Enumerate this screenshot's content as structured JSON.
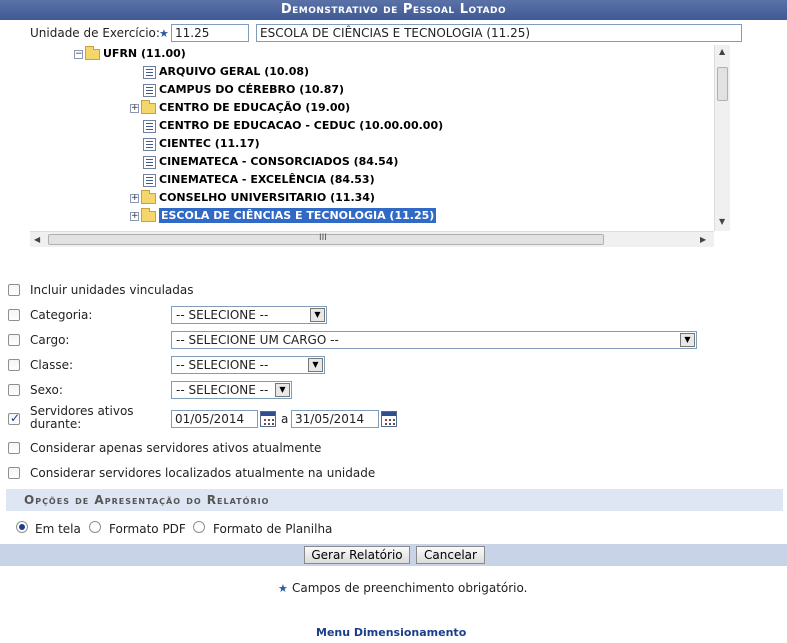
{
  "page": {
    "title": "Demonstrativo de Pessoal Lotado"
  },
  "unidade": {
    "label": "Unidade de Exercício:",
    "required_star": "★",
    "code": "11.25",
    "name": "ESCOLA DE CIÊNCIAS E TECNOLOGIA (11.25)"
  },
  "tree": {
    "root": "UFRN (11.00)",
    "items": [
      {
        "label": "ARQUIVO GERAL (10.08)",
        "icon": "document-icon",
        "expandable": false
      },
      {
        "label": "CAMPUS DO CÉREBRO (10.87)",
        "icon": "document-icon",
        "expandable": false
      },
      {
        "label": "CENTRO DE EDUCAÇÃO (19.00)",
        "icon": "folder-icon",
        "expandable": true
      },
      {
        "label": "CENTRO DE EDUCACAO - CEDUC (10.00.00.00)",
        "icon": "document-icon",
        "expandable": false
      },
      {
        "label": "CIENTEC (11.17)",
        "icon": "document-icon",
        "expandable": false
      },
      {
        "label": "CINEMATECA - CONSORCIADOS (84.54)",
        "icon": "document-icon",
        "expandable": false
      },
      {
        "label": "CINEMATECA - EXCELÊNCIA (84.53)",
        "icon": "document-icon",
        "expandable": false
      },
      {
        "label": "CONSELHO UNIVERSITARIO (11.34)",
        "icon": "folder-icon",
        "expandable": true
      },
      {
        "label": "ESCOLA DE CIÊNCIAS E TECNOLOGIA (11.25)",
        "icon": "folder-icon",
        "expandable": true,
        "selected": true
      }
    ],
    "hscroll_grip": "III"
  },
  "filters": {
    "incluir_unidades": {
      "label": "Incluir unidades vinculadas",
      "checked": false
    },
    "categoria": {
      "label": "Categoria:",
      "checked": false,
      "value": "-- SELECIONE --"
    },
    "cargo": {
      "label": "Cargo:",
      "checked": false,
      "value": "-- SELECIONE UM CARGO --"
    },
    "classe": {
      "label": "Classe:",
      "checked": false,
      "value": "-- SELECIONE --"
    },
    "sexo": {
      "label": "Sexo:",
      "checked": false,
      "value": "-- SELECIONE --"
    },
    "servidores_ativos": {
      "label_line1": "Servidores ativos",
      "label_line2": "durante:",
      "checked": true,
      "from": "01/05/2014",
      "separator": "a",
      "to": "31/05/2014"
    },
    "apenas_ativos": {
      "label": "Considerar apenas servidores ativos atualmente",
      "checked": false
    },
    "localizados": {
      "label": "Considerar servidores localizados atualmente na unidade",
      "checked": false
    }
  },
  "apresentacao": {
    "title": "Opções de Apresentação do Relatório",
    "options": [
      {
        "label": "Em tela",
        "selected": true
      },
      {
        "label": "Formato PDF",
        "selected": false
      },
      {
        "label": "Formato de Planilha",
        "selected": false
      }
    ]
  },
  "buttons": {
    "gerar": "Gerar Relatório",
    "cancelar": "Cancelar"
  },
  "footer": {
    "required_note_star": "★",
    "required_note": "Campos de preenchimento obrigatório.",
    "menu_link": "Menu Dimensionamento"
  },
  "colors": {
    "title_bar": "#3f5993",
    "section_bar": "#dfe6f3",
    "footer_bar": "#c8d3e8",
    "selection": "#3169c6",
    "link": "#1b3e8a"
  }
}
